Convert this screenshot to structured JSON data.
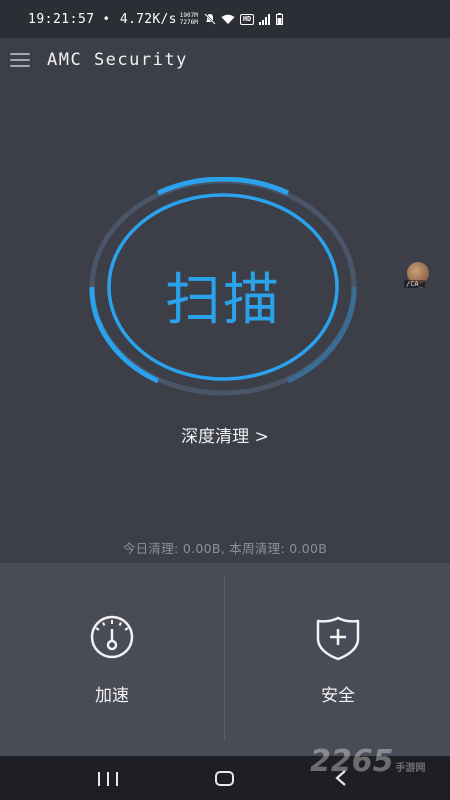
{
  "status_bar": {
    "time": "19:21:57",
    "separator": "•",
    "speed": "4.72K/s",
    "speed_detail_top": "1907M",
    "speed_detail_bottom": "7276M",
    "badge": "HD",
    "icons": [
      "mute-icon",
      "wifi-icon",
      "hd-badge",
      "signal-icon",
      "battery-icon"
    ]
  },
  "app_bar": {
    "title": "AMC Security",
    "menu_icon": "hamburger-menu-icon"
  },
  "scan": {
    "label": "扫描",
    "accent_color": "#2aa3ec"
  },
  "deep_clean": {
    "label": "深度清理 >"
  },
  "float_widget": {
    "caption": "/CA_"
  },
  "stats": {
    "text": "今日清理: 0.00B, 本周清理: 0.00B"
  },
  "actions": {
    "accelerate": {
      "label": "加速",
      "icon": "speedometer-icon"
    },
    "security": {
      "label": "安全",
      "icon": "shield-plus-icon"
    }
  },
  "nav_bar": {
    "recents": "recents-icon",
    "home": "home-icon",
    "back": "back-icon"
  },
  "watermark": {
    "text": "2265",
    "sub": "手游网"
  }
}
